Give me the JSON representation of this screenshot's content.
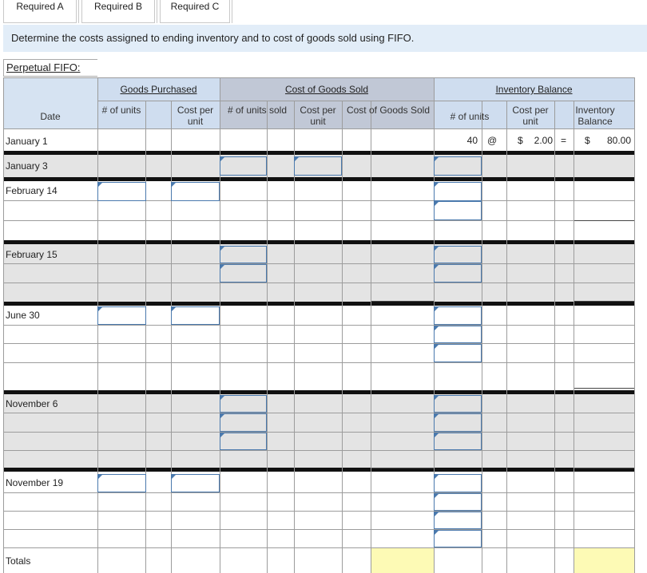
{
  "tabs": [
    "Required A",
    "Required B",
    "Required C"
  ],
  "instruction": "Determine the costs assigned to ending inventory and to cost of goods sold using FIFO.",
  "table_title": "Perpetual FIFO:",
  "groups": {
    "purchased": "Goods Purchased",
    "cogs": "Cost of Goods Sold",
    "inventory": "Inventory Balance"
  },
  "headers": {
    "date": "Date",
    "p_units": "# of units",
    "p_cost": "Cost per unit",
    "c_units": "# of units sold",
    "c_cost": "Cost per unit",
    "c_total": "Cost of Goods Sold",
    "i_units": "# of units",
    "i_cost": "Cost per unit",
    "i_total": "Inventory Balance"
  },
  "dates": [
    "January 1",
    "January 3",
    "February 14",
    "February 15",
    "June 30",
    "November 6",
    "November 19",
    "Totals"
  ],
  "jan1": {
    "units": "40",
    "at": "@",
    "dollar1": "$",
    "cost": "2.00",
    "equals": "=",
    "dollar2": "$",
    "balance": "80.00"
  }
}
